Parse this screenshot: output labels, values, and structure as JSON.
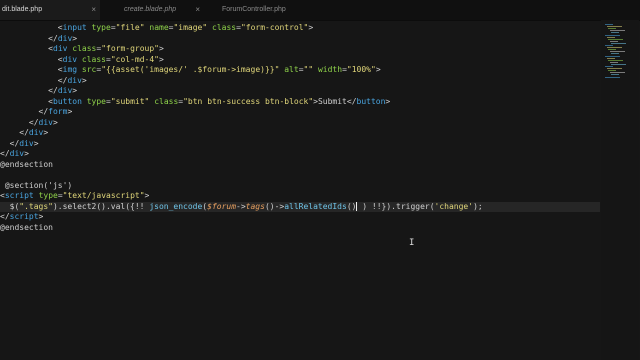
{
  "tabs": [
    {
      "label": "dit.blade.php",
      "active": true
    },
    {
      "label": "create.blade.php",
      "active": false
    },
    {
      "label": "ForumController.php",
      "active": false
    }
  ],
  "code": [
    {
      "tokens": [
        {
          "t": "            ",
          "c": "plain"
        },
        {
          "t": "<",
          "c": "plain"
        },
        {
          "t": "input",
          "c": "tag"
        },
        {
          "t": " ",
          "c": "plain"
        },
        {
          "t": "type",
          "c": "attr"
        },
        {
          "t": "=",
          "c": "plain"
        },
        {
          "t": "\"file\"",
          "c": "str"
        },
        {
          "t": " ",
          "c": "plain"
        },
        {
          "t": "name",
          "c": "attr"
        },
        {
          "t": "=",
          "c": "plain"
        },
        {
          "t": "\"image\"",
          "c": "str"
        },
        {
          "t": " ",
          "c": "plain"
        },
        {
          "t": "class",
          "c": "attr"
        },
        {
          "t": "=",
          "c": "plain"
        },
        {
          "t": "\"form-control\"",
          "c": "str"
        },
        {
          "t": ">",
          "c": "plain"
        }
      ]
    },
    {
      "tokens": [
        {
          "t": "          ",
          "c": "plain"
        },
        {
          "t": "</",
          "c": "plain"
        },
        {
          "t": "div",
          "c": "tag"
        },
        {
          "t": ">",
          "c": "plain"
        }
      ]
    },
    {
      "tokens": [
        {
          "t": "          ",
          "c": "plain"
        },
        {
          "t": "<",
          "c": "plain"
        },
        {
          "t": "div",
          "c": "tag"
        },
        {
          "t": " ",
          "c": "plain"
        },
        {
          "t": "class",
          "c": "attr"
        },
        {
          "t": "=",
          "c": "plain"
        },
        {
          "t": "\"form-group\"",
          "c": "str"
        },
        {
          "t": ">",
          "c": "plain"
        }
      ]
    },
    {
      "tokens": [
        {
          "t": "            ",
          "c": "plain"
        },
        {
          "t": "<",
          "c": "plain"
        },
        {
          "t": "div",
          "c": "tag"
        },
        {
          "t": " ",
          "c": "plain"
        },
        {
          "t": "class",
          "c": "attr"
        },
        {
          "t": "=",
          "c": "plain"
        },
        {
          "t": "\"col-md-4\"",
          "c": "str"
        },
        {
          "t": ">",
          "c": "plain"
        }
      ]
    },
    {
      "tokens": [
        {
          "t": "            ",
          "c": "plain"
        },
        {
          "t": "<",
          "c": "plain"
        },
        {
          "t": "img",
          "c": "tag"
        },
        {
          "t": " ",
          "c": "plain"
        },
        {
          "t": "src",
          "c": "attr"
        },
        {
          "t": "=",
          "c": "plain"
        },
        {
          "t": "\"{{asset('images/' .$forum->image)}}\"",
          "c": "str"
        },
        {
          "t": " ",
          "c": "plain"
        },
        {
          "t": "alt",
          "c": "attr"
        },
        {
          "t": "=",
          "c": "plain"
        },
        {
          "t": "\"\"",
          "c": "str"
        },
        {
          "t": " ",
          "c": "plain"
        },
        {
          "t": "width",
          "c": "attr"
        },
        {
          "t": "=",
          "c": "plain"
        },
        {
          "t": "\"100%\"",
          "c": "str"
        },
        {
          "t": ">",
          "c": "plain"
        }
      ]
    },
    {
      "tokens": [
        {
          "t": "            ",
          "c": "plain"
        },
        {
          "t": "</",
          "c": "plain"
        },
        {
          "t": "div",
          "c": "tag"
        },
        {
          "t": ">",
          "c": "plain"
        }
      ]
    },
    {
      "tokens": [
        {
          "t": "          ",
          "c": "plain"
        },
        {
          "t": "</",
          "c": "plain"
        },
        {
          "t": "div",
          "c": "tag"
        },
        {
          "t": ">",
          "c": "plain"
        }
      ]
    },
    {
      "tokens": [
        {
          "t": "          ",
          "c": "plain"
        },
        {
          "t": "<",
          "c": "plain"
        },
        {
          "t": "button",
          "c": "tag"
        },
        {
          "t": " ",
          "c": "plain"
        },
        {
          "t": "type",
          "c": "attr"
        },
        {
          "t": "=",
          "c": "plain"
        },
        {
          "t": "\"submit\"",
          "c": "str"
        },
        {
          "t": " ",
          "c": "plain"
        },
        {
          "t": "class",
          "c": "attr"
        },
        {
          "t": "=",
          "c": "plain"
        },
        {
          "t": "\"btn btn-success btn-block\"",
          "c": "str"
        },
        {
          "t": ">Submit</",
          "c": "plain"
        },
        {
          "t": "button",
          "c": "tag"
        },
        {
          "t": ">",
          "c": "plain"
        }
      ]
    },
    {
      "tokens": [
        {
          "t": "        ",
          "c": "plain"
        },
        {
          "t": "</",
          "c": "plain"
        },
        {
          "t": "form",
          "c": "tag"
        },
        {
          "t": ">",
          "c": "plain"
        }
      ]
    },
    {
      "tokens": [
        {
          "t": "      ",
          "c": "plain"
        },
        {
          "t": "</",
          "c": "plain"
        },
        {
          "t": "div",
          "c": "tag"
        },
        {
          "t": ">",
          "c": "plain"
        }
      ]
    },
    {
      "tokens": [
        {
          "t": "    ",
          "c": "plain"
        },
        {
          "t": "</",
          "c": "plain"
        },
        {
          "t": "div",
          "c": "tag"
        },
        {
          "t": ">",
          "c": "plain"
        }
      ]
    },
    {
      "tokens": [
        {
          "t": "  ",
          "c": "plain"
        },
        {
          "t": "</",
          "c": "plain"
        },
        {
          "t": "div",
          "c": "tag"
        },
        {
          "t": ">",
          "c": "plain"
        }
      ]
    },
    {
      "tokens": [
        {
          "t": "</",
          "c": "plain"
        },
        {
          "t": "div",
          "c": "tag"
        },
        {
          "t": ">",
          "c": "plain"
        }
      ]
    },
    {
      "tokens": [
        {
          "t": "@endsection",
          "c": "blade"
        }
      ]
    },
    {
      "tokens": [
        {
          "t": "",
          "c": "plain"
        }
      ]
    },
    {
      "tokens": [
        {
          "t": " @section('js')",
          "c": "blade"
        }
      ]
    },
    {
      "tokens": [
        {
          "t": "<",
          "c": "plain"
        },
        {
          "t": "script",
          "c": "tag"
        },
        {
          "t": " ",
          "c": "plain"
        },
        {
          "t": "type",
          "c": "attr"
        },
        {
          "t": "=",
          "c": "plain"
        },
        {
          "t": "\"text/javascript\"",
          "c": "str"
        },
        {
          "t": ">",
          "c": "plain"
        }
      ]
    },
    {
      "tokens": [
        {
          "t": "  $(",
          "c": "plain"
        },
        {
          "t": "\".tags\"",
          "c": "str"
        },
        {
          "t": ").select2().val({!! ",
          "c": "plain"
        },
        {
          "t": "json_encode",
          "c": "fn"
        },
        {
          "t": "(",
          "c": "plain"
        },
        {
          "t": "$forum",
          "c": "var"
        },
        {
          "t": "->",
          "c": "plain"
        },
        {
          "t": "tags",
          "c": "var"
        },
        {
          "t": "()->",
          "c": "plain"
        },
        {
          "t": "allRelatedIds",
          "c": "fn"
        },
        {
          "t": "()",
          "c": "plain"
        },
        {
          "t": "CURSOR",
          "c": "cursor"
        },
        {
          "t": " ) !!}).trigger(",
          "c": "plain"
        },
        {
          "t": "'change'",
          "c": "str"
        },
        {
          "t": ");",
          "c": "plain"
        }
      ],
      "highlight": true
    },
    {
      "tokens": [
        {
          "t": "</",
          "c": "plain"
        },
        {
          "t": "script",
          "c": "tag"
        },
        {
          "t": ">",
          "c": "plain"
        }
      ]
    },
    {
      "tokens": [
        {
          "t": "@endsection",
          "c": "blade"
        }
      ]
    }
  ],
  "colors": {
    "background": "#161616",
    "tag": "#4aa5e0",
    "attribute": "#8fd24a",
    "string": "#e0d67a",
    "text": "#cfcfcf"
  }
}
